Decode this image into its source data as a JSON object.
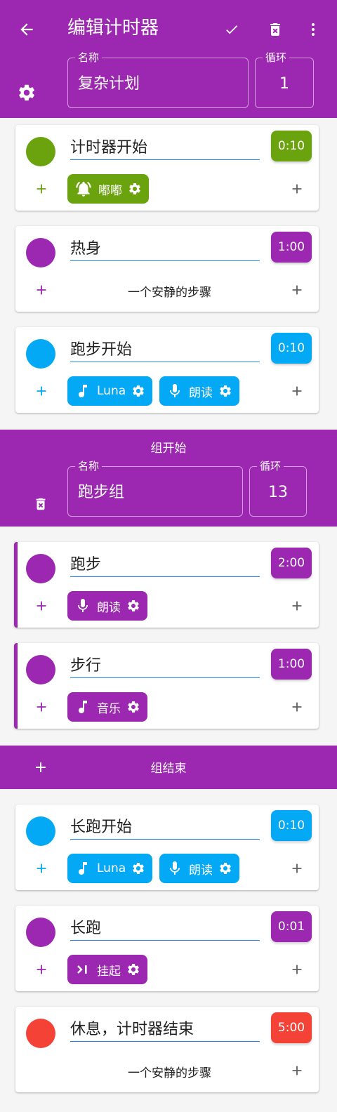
{
  "header": {
    "title": "编辑计时器",
    "name_label": "名称",
    "name_value": "复杂计划",
    "loop_label": "循环",
    "loop_value": "1",
    "icons": [
      "back-arrow-icon",
      "check-icon",
      "delete-icon",
      "more-vert-icon",
      "settings-icon"
    ]
  },
  "colors": {
    "primary": "#9c27b0",
    "green": "#6aa30d",
    "blue": "#03a9f4",
    "purple": "#9c27b0",
    "red": "#f44336",
    "plus_gray": "#616161"
  },
  "steps_top": [
    {
      "name": "计时器开始",
      "duration": "0:10",
      "color": "green",
      "chips": [
        {
          "label": "嘟嘟",
          "icon": "bell-icon"
        }
      ]
    },
    {
      "name": "热身",
      "duration": "1:00",
      "color": "purple",
      "quiet": "一个安静的步骤"
    },
    {
      "name": "跑步开始",
      "duration": "0:10",
      "color": "blue",
      "chips": [
        {
          "label": "Luna",
          "icon": "music-note-icon"
        },
        {
          "label": "朗读",
          "icon": "mic-icon"
        }
      ]
    }
  ],
  "group": {
    "start_title": "组开始",
    "name_label": "名称",
    "name_value": "跑步组",
    "loop_label": "循环",
    "loop_value": "13",
    "end_title": "组结束",
    "steps": [
      {
        "name": "跑步",
        "duration": "2:00",
        "color": "purple",
        "chips": [
          {
            "label": "朗读",
            "icon": "mic-icon"
          }
        ]
      },
      {
        "name": "步行",
        "duration": "1:00",
        "color": "purple",
        "chips": [
          {
            "label": "音乐",
            "icon": "music-note-icon"
          }
        ]
      }
    ]
  },
  "steps_bottom": [
    {
      "name": "长跑开始",
      "duration": "0:10",
      "color": "blue",
      "chips": [
        {
          "label": "Luna",
          "icon": "music-note-icon"
        },
        {
          "label": "朗读",
          "icon": "mic-icon"
        }
      ]
    },
    {
      "name": "长跑",
      "duration": "0:01",
      "color": "purple",
      "chips": [
        {
          "label": "挂起",
          "icon": "pause-step-icon"
        }
      ]
    },
    {
      "name": "休息，计时器结束",
      "duration": "5:00",
      "color": "red",
      "quiet": "一个安静的步骤"
    }
  ]
}
